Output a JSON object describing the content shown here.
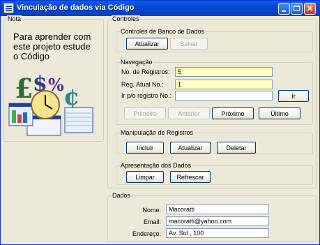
{
  "window": {
    "title": "Vinculação de dados via Código"
  },
  "note": {
    "group_title": "Nota",
    "text": "Para aprender com este projeto estude o Código"
  },
  "controls": {
    "group_title": "Controles",
    "db": {
      "title": "Controles de Banco de Dados",
      "update_label": "Atualizar",
      "save_label": "Salvar"
    },
    "nav": {
      "title": "Navegação",
      "record_count_label": "No. de Registros:",
      "record_count_value": "5",
      "current_record_label": "Reg. Atual No.:",
      "current_record_value": "1",
      "goto_label": "Ir p/o registro No.:",
      "goto_value": "",
      "go_label": "Ir",
      "first_label": "Primeiro",
      "prev_label": "Anterior",
      "next_label": "Próximo",
      "last_label": "Último"
    },
    "manip": {
      "title": "Manipulação de Registros",
      "insert_label": "Incluir",
      "update_label": "Atualizar",
      "delete_label": "Deletar"
    },
    "present": {
      "title": "Apresentação dos Dados",
      "clear_label": "Limpar",
      "refresh_label": "Refrescar"
    }
  },
  "data": {
    "group_title": "Dados",
    "name_label": "Nome:",
    "name_value": "Macoratti",
    "email_label": "Email:",
    "email_value": "macoratti@yahoo.com",
    "address_label": "Endereço:",
    "address_value": "Av. Sol , 100"
  },
  "colors": {
    "titlebar": "#0648d0",
    "window_bg": "#ece9d8",
    "highlight_input": "#ffffc0"
  }
}
